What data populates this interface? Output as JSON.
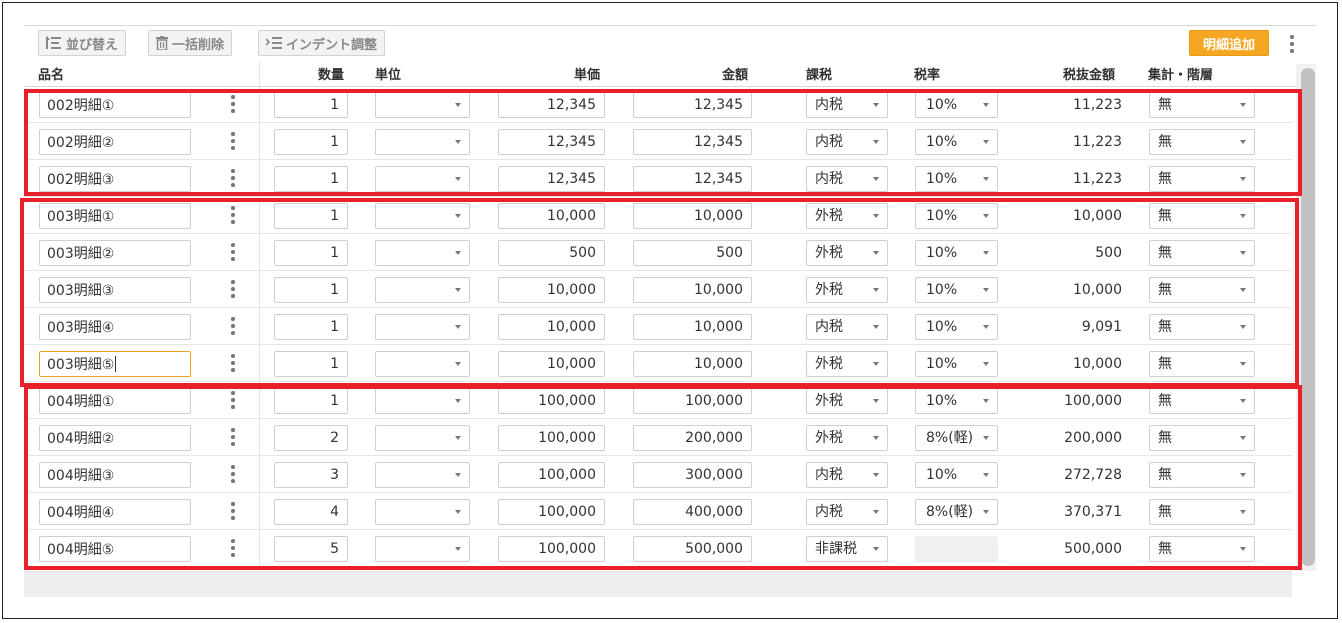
{
  "toolbar": {
    "sort_label": "並び替え",
    "bulk_delete_label": "一括削除",
    "indent_label": "インデント調整",
    "add_detail_label": "明細追加",
    "more_icon": "more-vert-icon"
  },
  "columns": {
    "name": "品名",
    "qty": "数量",
    "unit": "単位",
    "price": "単価",
    "amount": "金額",
    "tax_type": "課税",
    "tax_rate": "税率",
    "net": "税抜金額",
    "aggregate": "集計・階層"
  },
  "rows": [
    {
      "name": "002明細①",
      "qty": "1",
      "unit": "",
      "price": "12,345",
      "amount": "12,345",
      "tax_type": "内税",
      "tax_rate": "10%",
      "net": "11,223",
      "aggregate": "無"
    },
    {
      "name": "002明細②",
      "qty": "1",
      "unit": "",
      "price": "12,345",
      "amount": "12,345",
      "tax_type": "内税",
      "tax_rate": "10%",
      "net": "11,223",
      "aggregate": "無"
    },
    {
      "name": "002明細③",
      "qty": "1",
      "unit": "",
      "price": "12,345",
      "amount": "12,345",
      "tax_type": "内税",
      "tax_rate": "10%",
      "net": "11,223",
      "aggregate": "無"
    },
    {
      "name": "003明細①",
      "qty": "1",
      "unit": "",
      "price": "10,000",
      "amount": "10,000",
      "tax_type": "外税",
      "tax_rate": "10%",
      "net": "10,000",
      "aggregate": "無"
    },
    {
      "name": "003明細②",
      "qty": "1",
      "unit": "",
      "price": "500",
      "amount": "500",
      "tax_type": "外税",
      "tax_rate": "10%",
      "net": "500",
      "aggregate": "無"
    },
    {
      "name": "003明細③",
      "qty": "1",
      "unit": "",
      "price": "10,000",
      "amount": "10,000",
      "tax_type": "外税",
      "tax_rate": "10%",
      "net": "10,000",
      "aggregate": "無"
    },
    {
      "name": "003明細④",
      "qty": "1",
      "unit": "",
      "price": "10,000",
      "amount": "10,000",
      "tax_type": "内税",
      "tax_rate": "10%",
      "net": "9,091",
      "aggregate": "無"
    },
    {
      "name": "003明細⑤",
      "qty": "1",
      "unit": "",
      "price": "10,000",
      "amount": "10,000",
      "tax_type": "外税",
      "tax_rate": "10%",
      "net": "10,000",
      "aggregate": "無"
    },
    {
      "name": "004明細①",
      "qty": "1",
      "unit": "",
      "price": "100,000",
      "amount": "100,000",
      "tax_type": "外税",
      "tax_rate": "10%",
      "net": "100,000",
      "aggregate": "無"
    },
    {
      "name": "004明細②",
      "qty": "2",
      "unit": "",
      "price": "100,000",
      "amount": "200,000",
      "tax_type": "外税",
      "tax_rate": "8%(軽)",
      "net": "200,000",
      "aggregate": "無"
    },
    {
      "name": "004明細③",
      "qty": "3",
      "unit": "",
      "price": "100,000",
      "amount": "300,000",
      "tax_type": "内税",
      "tax_rate": "10%",
      "net": "272,728",
      "aggregate": "無"
    },
    {
      "name": "004明細④",
      "qty": "4",
      "unit": "",
      "price": "100,000",
      "amount": "400,000",
      "tax_type": "内税",
      "tax_rate": "8%(軽)",
      "net": "370,371",
      "aggregate": "無"
    },
    {
      "name": "004明細⑤",
      "qty": "5",
      "unit": "",
      "price": "100,000",
      "amount": "500,000",
      "tax_type": "非課税",
      "tax_rate": "",
      "net": "500,000",
      "aggregate": "無"
    }
  ],
  "colors": {
    "accent": "#f5a623",
    "highlight": "#e8202a",
    "focus_border": "#f0a020"
  }
}
